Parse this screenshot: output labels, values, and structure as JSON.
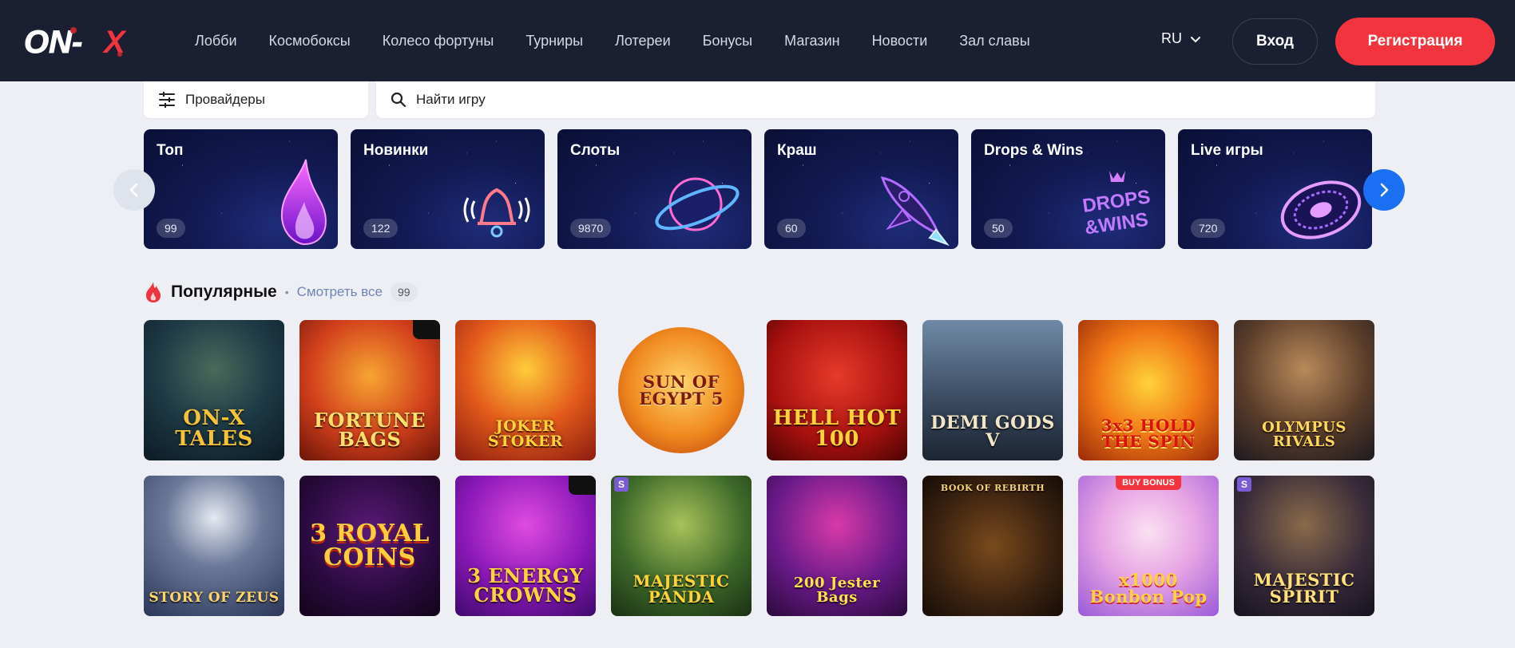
{
  "header": {
    "logo_text": "ON-X",
    "nav": [
      "Лобби",
      "Космобоксы",
      "Колесо фортуны",
      "Турниры",
      "Лотереи",
      "Бонусы",
      "Магазин",
      "Новости",
      "Зал славы"
    ],
    "language": "RU",
    "login_label": "Вход",
    "register_label": "Регистрация"
  },
  "filters": {
    "providers_label": "Провайдеры",
    "search_placeholder": "Найти игру"
  },
  "categories": [
    {
      "title": "Топ",
      "count": "99",
      "icon": "flame-icon"
    },
    {
      "title": "Новинки",
      "count": "122",
      "icon": "bell-icon"
    },
    {
      "title": "Слоты",
      "count": "9870",
      "icon": "planet-icon"
    },
    {
      "title": "Краш",
      "count": "60",
      "icon": "rocket-icon"
    },
    {
      "title": "Drops & Wins",
      "count": "50",
      "icon": "drops-wins-icon"
    },
    {
      "title": "Live игры",
      "count": "720",
      "icon": "roulette-icon"
    }
  ],
  "popular": {
    "title": "Популярные",
    "separator": "•",
    "see_all_label": "Смотреть все",
    "count": "99"
  },
  "games": [
    {
      "name": "ON-X TALES"
    },
    {
      "name": "FORTUNE BAGS"
    },
    {
      "name": "JOKER STOKER"
    },
    {
      "name": "SUN OF EGYPT 5"
    },
    {
      "name": "HELL HOT 100"
    },
    {
      "name": "DEMI GODS V"
    },
    {
      "name": "3x3 HOLD THE SPIN"
    },
    {
      "name": "OLYMPUS RIVALS"
    },
    {
      "name": "STORY OF ZEUS"
    },
    {
      "name": "3 ROYAL COINS"
    },
    {
      "name": "3 ENERGY CROWNS"
    },
    {
      "name": "MAJESTIC PANDA"
    },
    {
      "name": "200 Jester Bags"
    },
    {
      "name": "BOOK OF REBIRTH"
    },
    {
      "name": "x1000 Bonbon Pop",
      "badge": "BUY BONUS"
    },
    {
      "name": "MAJESTIC SPIRIT"
    }
  ],
  "colors": {
    "header_bg": "#1a1f31",
    "accent_red": "#f2343f",
    "accent_blue": "#1a6ff2",
    "page_bg": "#edeff4"
  }
}
